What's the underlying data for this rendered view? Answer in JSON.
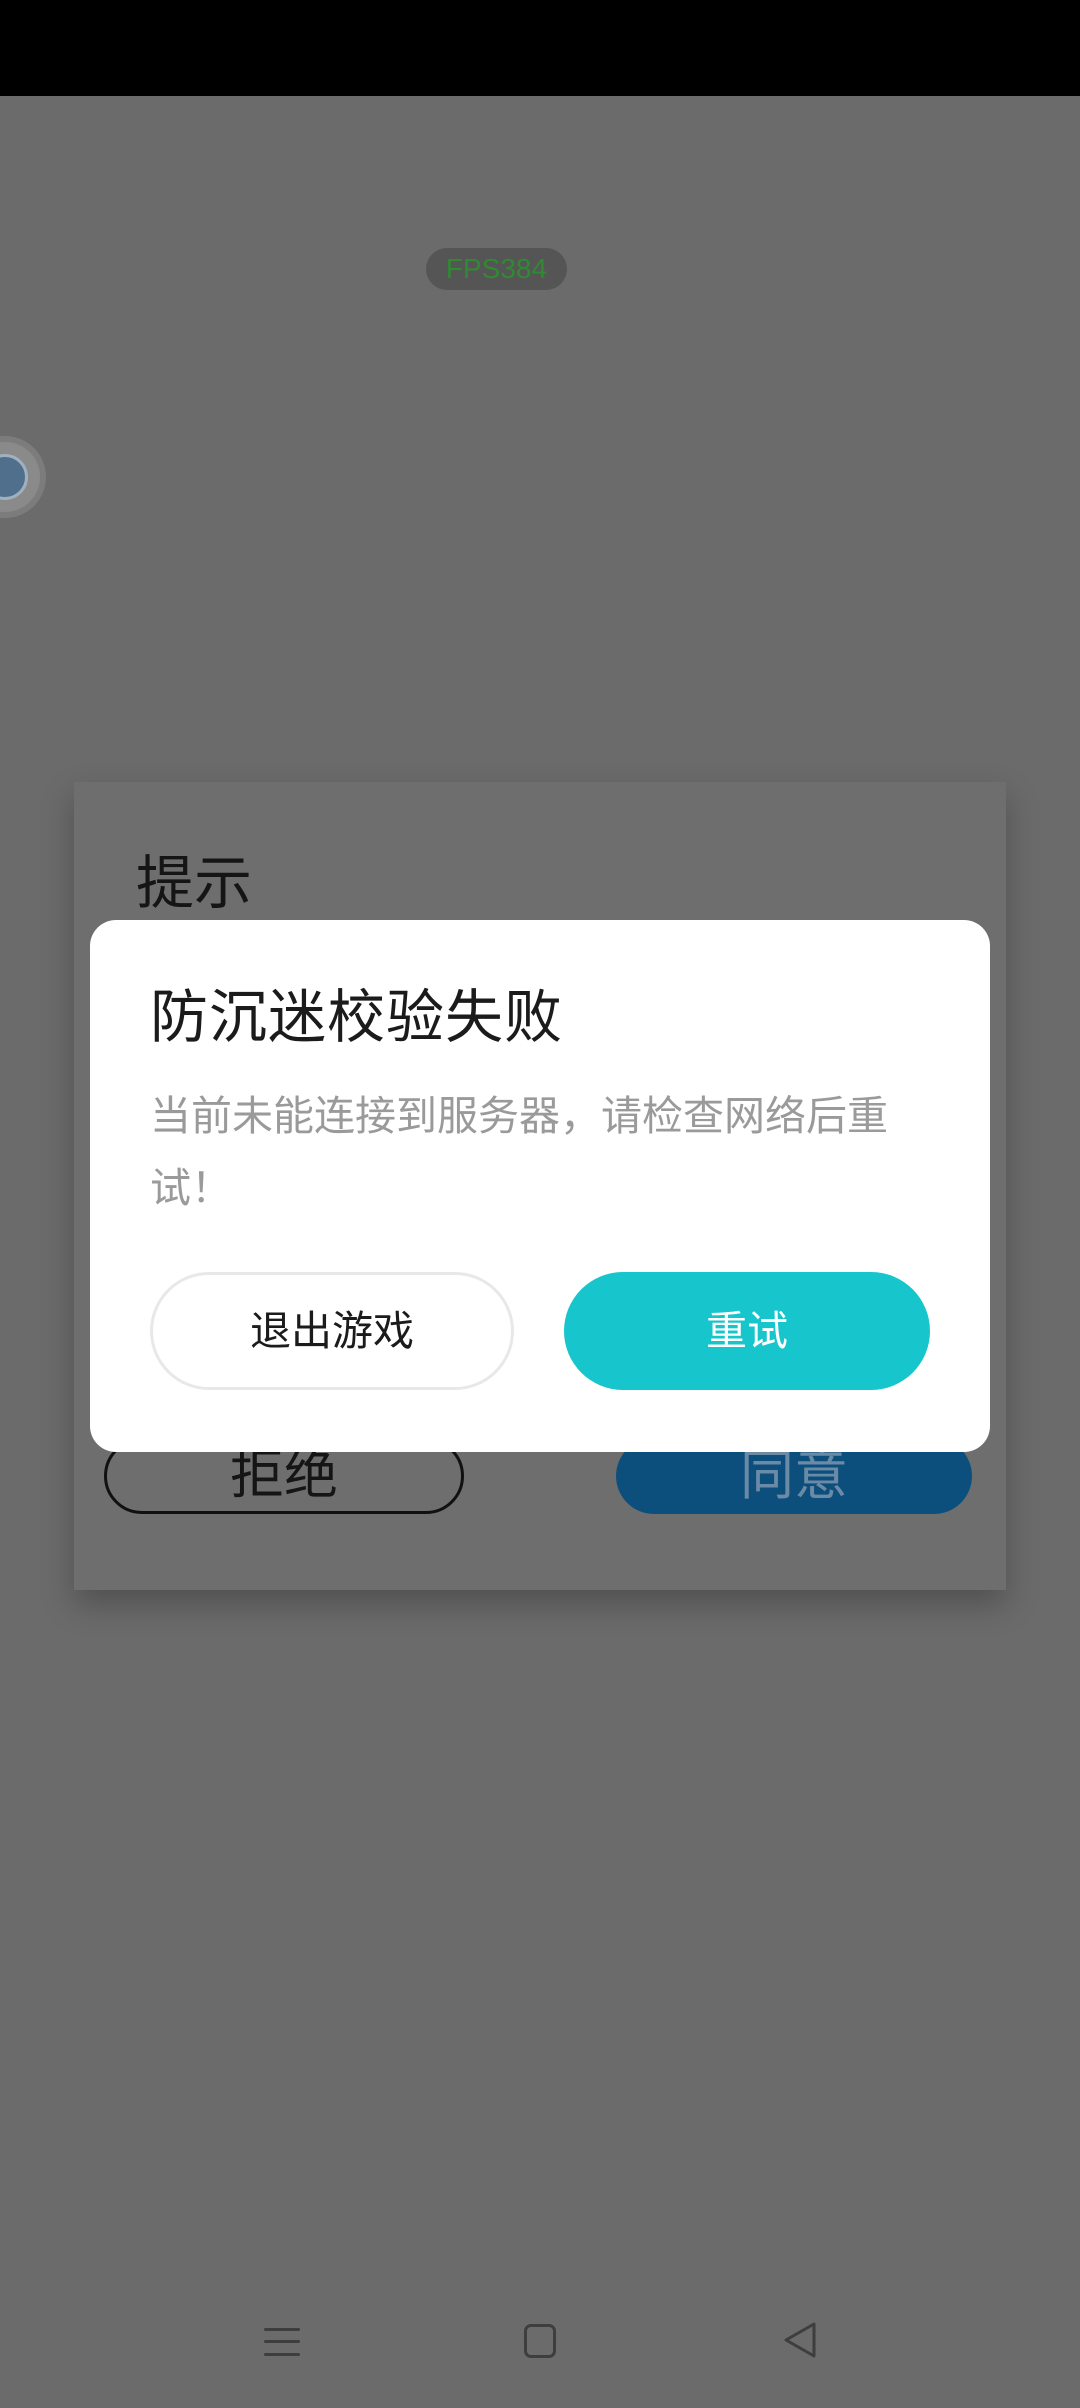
{
  "overlay": {
    "fps_label": "FPS384"
  },
  "background_dialog": {
    "title": "提示",
    "reject_label": "拒绝",
    "agree_label": "同意"
  },
  "modal": {
    "title": "防沉迷校验失败",
    "message": "当前未能连接到服务器，请检查网络后重试！",
    "exit_label": "退出游戏",
    "retry_label": "重试"
  },
  "colors": {
    "retry_button": "#17c5cc",
    "backdrop": "#6b6b6b",
    "agree_button_dim": "#0d4f7c"
  },
  "navbar": {
    "icons": [
      "menu-icon",
      "home-icon",
      "back-icon"
    ]
  }
}
